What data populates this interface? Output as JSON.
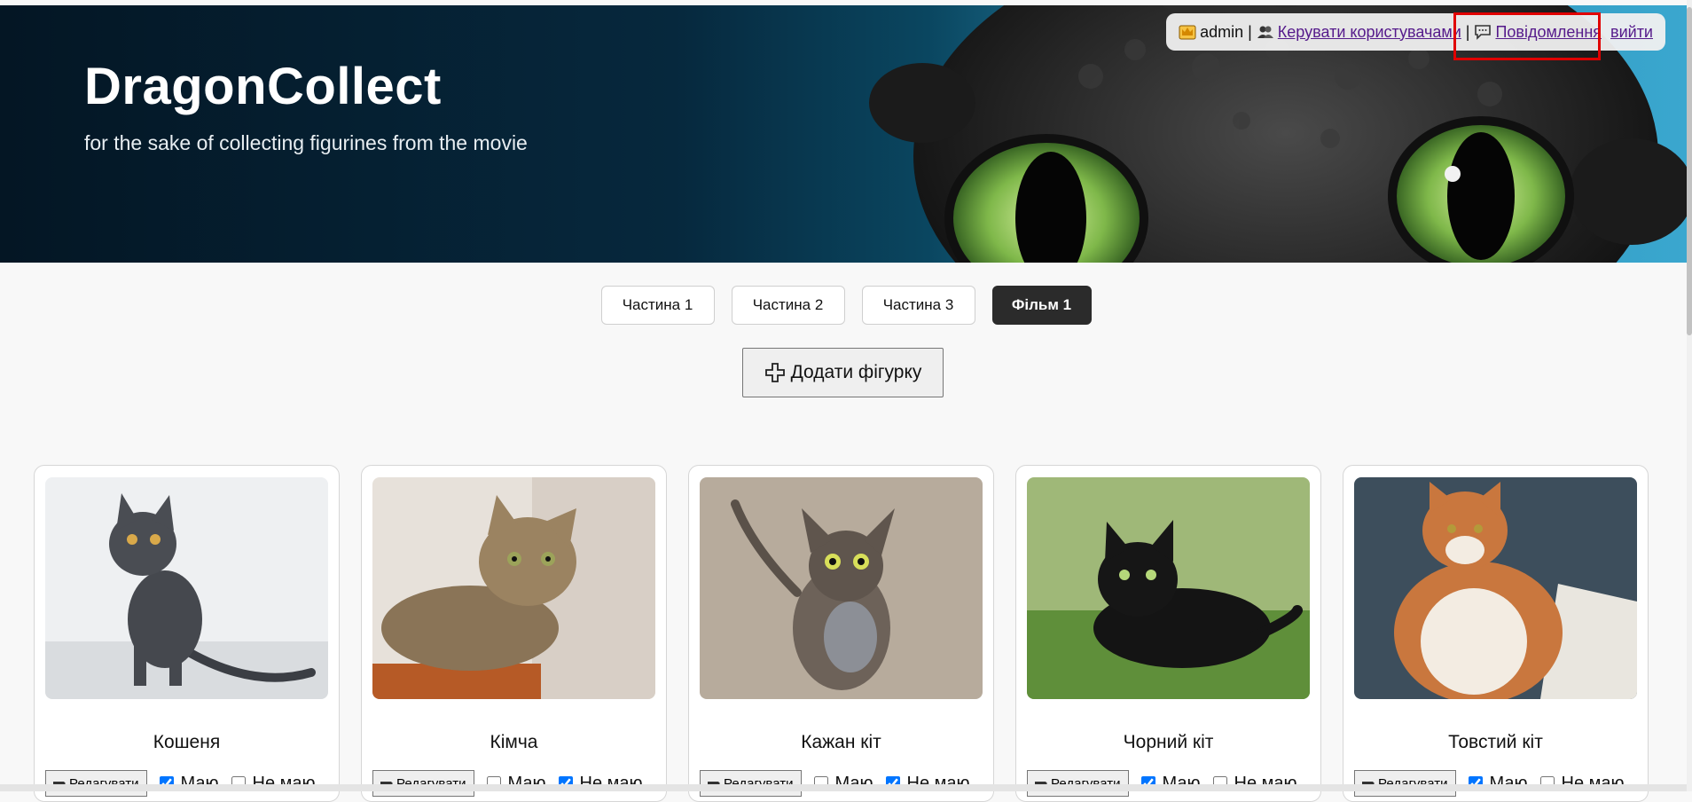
{
  "brand": {
    "title": "DragonCollect",
    "subtitle": "for the sake of collecting figurines from the movie"
  },
  "userbar": {
    "username": "admin",
    "separator": "|",
    "manage_users": "Керувати користувачами",
    "messages": "Повідомлення",
    "logout": "вийти"
  },
  "tabs": [
    {
      "label": "Частина 1",
      "active": false
    },
    {
      "label": "Частина 2",
      "active": false
    },
    {
      "label": "Частина 3",
      "active": false
    },
    {
      "label": "Фільм 1",
      "active": true
    }
  ],
  "add_button": {
    "label": "Додати фігурку",
    "icon": "plus-icon"
  },
  "cards": [
    {
      "name": "Кошеня",
      "edit_label": "Редагувати",
      "have_label": "Маю",
      "not_have_label": "Не маю",
      "have": true,
      "not_have": false
    },
    {
      "name": "Кімча",
      "edit_label": "Редагувати",
      "have_label": "Маю",
      "not_have_label": "Не маю",
      "have": false,
      "not_have": true
    },
    {
      "name": "Кажан кіт",
      "edit_label": "Редагувати",
      "have_label": "Маю",
      "not_have_label": "Не маю",
      "have": false,
      "not_have": true
    },
    {
      "name": "Чорний кіт",
      "edit_label": "Редагувати",
      "have_label": "Маю",
      "not_have_label": "Не маю",
      "have": true,
      "not_have": false
    },
    {
      "name": "Товстий кіт",
      "edit_label": "Редагувати",
      "have_label": "Маю",
      "not_have_label": "Не маю",
      "have": true,
      "not_have": false
    }
  ],
  "colors": {
    "active_tab": "#2b2b2b",
    "link": "#551a8b",
    "highlight": "#e00000",
    "checkbox": "#0a66d8"
  }
}
